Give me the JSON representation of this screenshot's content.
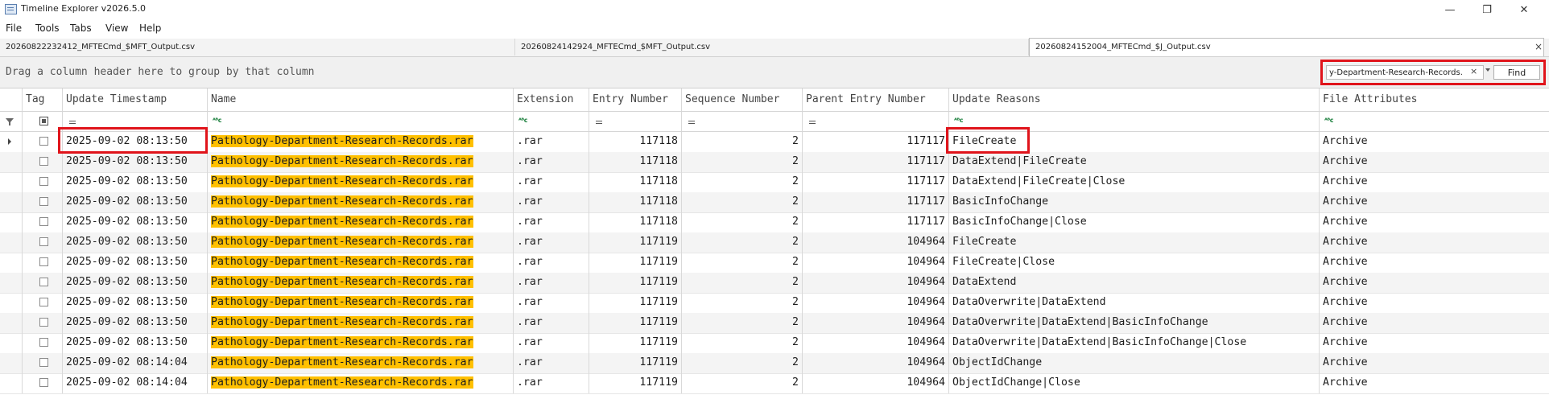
{
  "window": {
    "title": "Timeline Explorer v2026.5.0",
    "controls": {
      "minimize": "—",
      "maximize": "❐",
      "close": "✕"
    }
  },
  "menu": [
    "File",
    "Tools",
    "Tabs",
    "View",
    "Help"
  ],
  "tabs": [
    {
      "label": "20260822232412_MFTECmd_$MFT_Output.csv",
      "active": false
    },
    {
      "label": "20260824142924_MFTECmd_$MFT_Output.csv",
      "active": false
    },
    {
      "label": "20260824152004_MFTECmd_$J_Output.csv",
      "active": true
    }
  ],
  "tab_close": "×",
  "group_bar": {
    "text": "Drag a column header here to group by that column"
  },
  "find": {
    "value": "y-Department-Research-Records.",
    "clear": "×",
    "button": "Find"
  },
  "columns": [
    "Tag",
    "Update Timestamp",
    "Name",
    "Extension",
    "Entry Number",
    "Sequence Number",
    "Parent Entry Number",
    "Update Reasons",
    "File Attributes"
  ],
  "filter_row": {
    "text_filter": "ᴬᴮc"
  },
  "rows": [
    {
      "ts": "2025-09-02 08:13:50",
      "name": "Pathology-Department-Research-Records.rar",
      "ext": ".rar",
      "entry": "117118",
      "seq": "2",
      "parent": "117117",
      "reasons": "FileCreate",
      "attrs": "Archive"
    },
    {
      "ts": "2025-09-02 08:13:50",
      "name": "Pathology-Department-Research-Records.rar",
      "ext": ".rar",
      "entry": "117118",
      "seq": "2",
      "parent": "117117",
      "reasons": "DataExtend|FileCreate",
      "attrs": "Archive"
    },
    {
      "ts": "2025-09-02 08:13:50",
      "name": "Pathology-Department-Research-Records.rar",
      "ext": ".rar",
      "entry": "117118",
      "seq": "2",
      "parent": "117117",
      "reasons": "DataExtend|FileCreate|Close",
      "attrs": "Archive"
    },
    {
      "ts": "2025-09-02 08:13:50",
      "name": "Pathology-Department-Research-Records.rar",
      "ext": ".rar",
      "entry": "117118",
      "seq": "2",
      "parent": "117117",
      "reasons": "BasicInfoChange",
      "attrs": "Archive"
    },
    {
      "ts": "2025-09-02 08:13:50",
      "name": "Pathology-Department-Research-Records.rar",
      "ext": ".rar",
      "entry": "117118",
      "seq": "2",
      "parent": "117117",
      "reasons": "BasicInfoChange|Close",
      "attrs": "Archive"
    },
    {
      "ts": "2025-09-02 08:13:50",
      "name": "Pathology-Department-Research-Records.rar",
      "ext": ".rar",
      "entry": "117119",
      "seq": "2",
      "parent": "104964",
      "reasons": "FileCreate",
      "attrs": "Archive"
    },
    {
      "ts": "2025-09-02 08:13:50",
      "name": "Pathology-Department-Research-Records.rar",
      "ext": ".rar",
      "entry": "117119",
      "seq": "2",
      "parent": "104964",
      "reasons": "FileCreate|Close",
      "attrs": "Archive"
    },
    {
      "ts": "2025-09-02 08:13:50",
      "name": "Pathology-Department-Research-Records.rar",
      "ext": ".rar",
      "entry": "117119",
      "seq": "2",
      "parent": "104964",
      "reasons": "DataExtend",
      "attrs": "Archive"
    },
    {
      "ts": "2025-09-02 08:13:50",
      "name": "Pathology-Department-Research-Records.rar",
      "ext": ".rar",
      "entry": "117119",
      "seq": "2",
      "parent": "104964",
      "reasons": "DataOverwrite|DataExtend",
      "attrs": "Archive"
    },
    {
      "ts": "2025-09-02 08:13:50",
      "name": "Pathology-Department-Research-Records.rar",
      "ext": ".rar",
      "entry": "117119",
      "seq": "2",
      "parent": "104964",
      "reasons": "DataOverwrite|DataExtend|BasicInfoChange",
      "attrs": "Archive"
    },
    {
      "ts": "2025-09-02 08:13:50",
      "name": "Pathology-Department-Research-Records.rar",
      "ext": ".rar",
      "entry": "117119",
      "seq": "2",
      "parent": "104964",
      "reasons": "DataOverwrite|DataExtend|BasicInfoChange|Close",
      "attrs": "Archive"
    },
    {
      "ts": "2025-09-02 08:14:04",
      "name": "Pathology-Department-Research-Records.rar",
      "ext": ".rar",
      "entry": "117119",
      "seq": "2",
      "parent": "104964",
      "reasons": "ObjectIdChange",
      "attrs": "Archive"
    },
    {
      "ts": "2025-09-02 08:14:04",
      "name": "Pathology-Department-Research-Records.rar",
      "ext": ".rar",
      "entry": "117119",
      "seq": "2",
      "parent": "104964",
      "reasons": "ObjectIdChange|Close",
      "attrs": "Archive"
    }
  ],
  "colors": {
    "highlight": "#ffc000",
    "annotation": "#e0141b",
    "text_filter_icon": "#1a7f3c"
  }
}
